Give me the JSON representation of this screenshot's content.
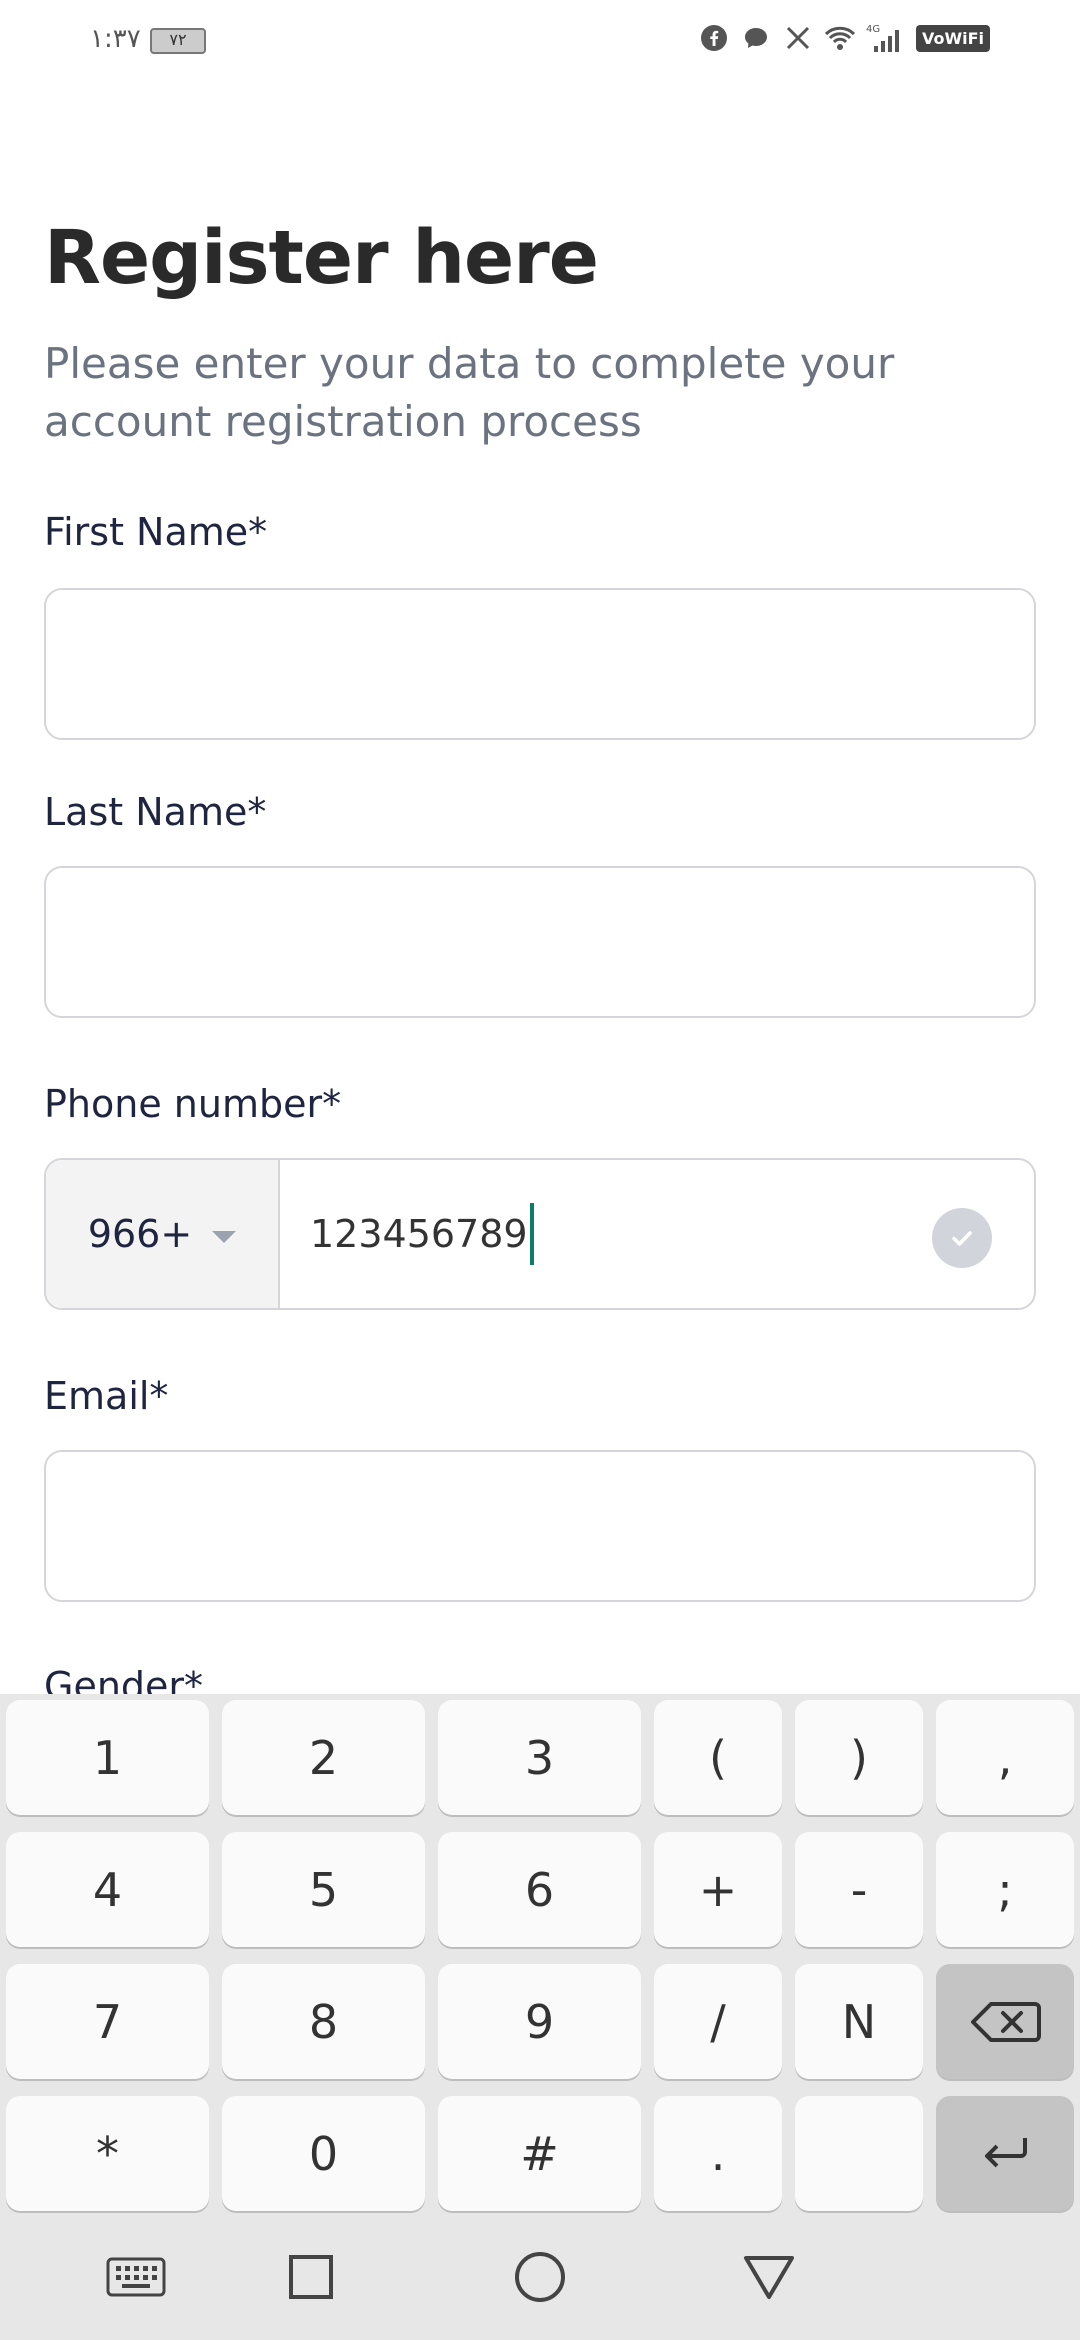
{
  "status_bar": {
    "time": "١:٣٧",
    "battery": "٧٢",
    "icons": [
      "facebook-icon",
      "chat-bubble-icon",
      "x-icon",
      "wifi-icon",
      "signal-4g-icon"
    ],
    "vowifi": "VoWiFi",
    "network": "4G"
  },
  "page": {
    "title": "Register here",
    "subtitle": "Please enter your data to complete your account registration process"
  },
  "form": {
    "first_name": {
      "label": "First Name*",
      "value": ""
    },
    "last_name": {
      "label": "Last Name*",
      "value": ""
    },
    "phone": {
      "label": "Phone number*",
      "country_code": "966+",
      "value": "123456789"
    },
    "email": {
      "label": "Email*",
      "value": ""
    },
    "gender": {
      "label": "Gender*"
    }
  },
  "keyboard": {
    "rows": [
      [
        "1",
        "2",
        "3",
        "(",
        ")",
        ","
      ],
      [
        "4",
        "5",
        "6",
        "+",
        "-",
        ";"
      ],
      [
        "7",
        "8",
        "9",
        "/",
        "N",
        "backspace"
      ],
      [
        "*",
        "0",
        "#",
        ".",
        " ",
        "enter"
      ]
    ]
  },
  "navbar": [
    "keyboard-icon",
    "recents-icon",
    "home-icon",
    "back-icon"
  ]
}
